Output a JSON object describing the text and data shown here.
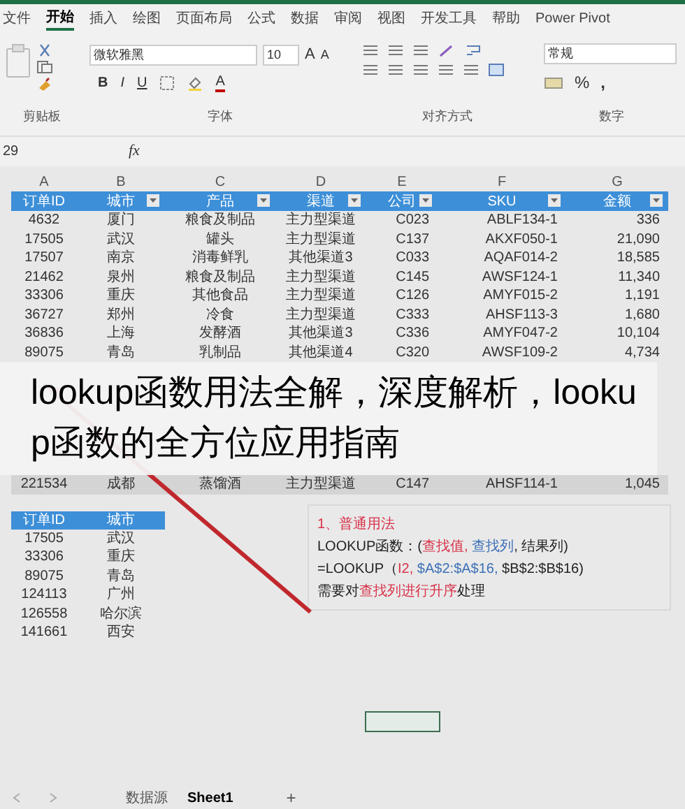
{
  "ribbon_tabs": [
    {
      "label": "文件",
      "selected": false
    },
    {
      "label": "开始",
      "selected": true
    },
    {
      "label": "插入",
      "selected": false
    },
    {
      "label": "绘图",
      "selected": false
    },
    {
      "label": "页面布局",
      "selected": false
    },
    {
      "label": "公式",
      "selected": false
    },
    {
      "label": "数据",
      "selected": false
    },
    {
      "label": "审阅",
      "selected": false
    },
    {
      "label": "视图",
      "selected": false
    },
    {
      "label": "开发工具",
      "selected": false
    },
    {
      "label": "帮助",
      "selected": false
    },
    {
      "label": "Power Pivot",
      "selected": false
    }
  ],
  "ribbon": {
    "font": "微软雅黑",
    "font_size": "10",
    "number_format": "常规",
    "bold": "B",
    "italic": "I",
    "underline": "U",
    "grow": "A",
    "shrink": "A",
    "font_color": "A",
    "percent": "%",
    "comma": ",",
    "groups": [
      "剪贴板",
      "字体",
      "对齐方式",
      "数字"
    ]
  },
  "name_box": "29",
  "formula_label": "fx",
  "columns": [
    "A",
    "B",
    "C",
    "D",
    "E",
    "F",
    "G"
  ],
  "table": {
    "headers": [
      "订单ID",
      "城市",
      "产品",
      "渠道",
      "公司",
      "SKU",
      "金额"
    ],
    "rows": [
      {
        "cells": [
          "4632",
          "厦门",
          "粮食及制品",
          "主力型渠道",
          "C023",
          "ABLF134-1",
          "336"
        ],
        "selected": false
      },
      {
        "cells": [
          "17505",
          "武汉",
          "罐头",
          "主力型渠道",
          "C137",
          "AKXF050-1",
          "21,090"
        ],
        "selected": false
      },
      {
        "cells": [
          "17507",
          "南京",
          "消毒鲜乳",
          "其他渠道3",
          "C033",
          "AQAF014-2",
          "18,585"
        ],
        "selected": false
      },
      {
        "cells": [
          "21462",
          "泉州",
          "粮食及制品",
          "主力型渠道",
          "C145",
          "AWSF124-1",
          "11,340"
        ],
        "selected": false
      },
      {
        "cells": [
          "33306",
          "重庆",
          "其他食品",
          "主力型渠道",
          "C126",
          "AMYF015-2",
          "1,191"
        ],
        "selected": false
      },
      {
        "cells": [
          "36727",
          "郑州",
          "冷食",
          "主力型渠道",
          "C333",
          "AHSF113-3",
          "1,680"
        ],
        "selected": false
      },
      {
        "cells": [
          "36836",
          "上海",
          "发酵酒",
          "其他渠道3",
          "C336",
          "AMYF047-2",
          "10,104"
        ],
        "selected": false
      },
      {
        "cells": [
          "89075",
          "青岛",
          "乳制品",
          "其他渠道4",
          "C320",
          "AWSF109-2",
          "4,734"
        ],
        "selected": false
      }
    ],
    "rows_below_title": [
      {
        "cells": [
          "221534",
          "成都",
          "蒸馏酒",
          "主力型渠道",
          "C147",
          "AHSF114-1",
          "1,045"
        ],
        "selected": true
      }
    ]
  },
  "lookup_table": {
    "headers": [
      "订单ID",
      "城市"
    ],
    "rows": [
      [
        "17505",
        "武汉"
      ],
      [
        "33306",
        "重庆"
      ],
      [
        "89075",
        "青岛"
      ],
      [
        "124113",
        "广州"
      ],
      [
        "126558",
        "哈尔滨"
      ],
      [
        "141661",
        "西安"
      ]
    ]
  },
  "note": {
    "lines": [
      [
        {
          "text": "1、普通用法",
          "color": "#d8334a"
        }
      ],
      [
        {
          "text": " LOOKUP函数：(",
          "color": "#222222"
        },
        {
          "text": "查找值,",
          "color": "#d8334a"
        },
        {
          "text": " 查找列",
          "color": "#3b6fb6"
        },
        {
          "text": ", 结果列)",
          "color": "#222222"
        }
      ],
      [
        {
          "text": "=LOOKUP（",
          "color": "#222222"
        },
        {
          "text": "I2,",
          "color": "#d8334a"
        },
        {
          "text": " $A$2:$A$16,",
          "color": "#3b6fb6"
        },
        {
          "text": " $B$2:$B$16)",
          "color": "#222222"
        }
      ],
      [
        {
          "text": "需要对",
          "color": "#222222"
        },
        {
          "text": "查找列进行升序",
          "color": "#d8334a"
        },
        {
          "text": "处理",
          "color": "#222222"
        }
      ]
    ]
  },
  "overlay_title": "lookup函数用法全解，深度解析，lookup函数的全方位应用指南",
  "sheet_tabs": [
    {
      "label": "数据源",
      "selected": false
    },
    {
      "label": "Sheet1",
      "selected": true
    }
  ],
  "add_sheet": "+"
}
